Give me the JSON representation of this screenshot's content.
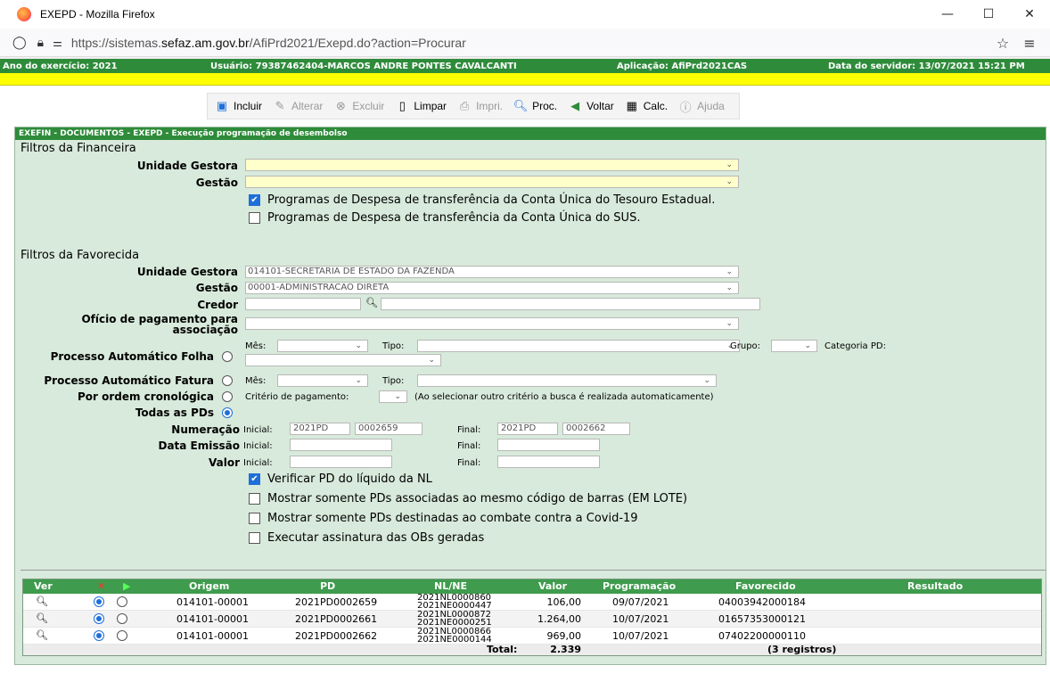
{
  "window": {
    "title": "EXEPD - Mozilla Firefox"
  },
  "browser": {
    "url_prefix": "https://sistemas.",
    "url_domain": "sefaz.am.gov.br",
    "url_path": "/AfiPrd2021/Exepd.do?action=Procurar"
  },
  "appbar": {
    "ano": "Ano do exercício: 2021",
    "usuario": "Usuário: 79387462404-MARCOS ANDRE PONTES CAVALCANTI",
    "aplicacao": "Aplicação: AfiPrd2021CAS",
    "data": "Data do servidor: 13/07/2021 15:21 PM"
  },
  "toolbar": {
    "incluir": "Incluir",
    "alterar": "Alterar",
    "excluir": "Excluir",
    "limpar": "Limpar",
    "imprimir": "Impri.",
    "proc": "Proc.",
    "voltar": "Voltar",
    "calc": "Calc.",
    "ajuda": "Ajuda"
  },
  "panel": {
    "title": "EXEFIN - DOCUMENTOS - EXEPD - Execução programação de desembolso"
  },
  "financeira": {
    "section": "Filtros da Financeira",
    "unidade_label": "Unidade Gestora",
    "gestao_label": "Gestão",
    "chk_tesouro": "Programas de Despesa de transferência da Conta Única do Tesouro Estadual.",
    "chk_sus": "Programas de Despesa de transferência da Conta Única do SUS."
  },
  "favorecida": {
    "section": "Filtros da Favorecida",
    "unidade_label": "Unidade Gestora",
    "unidade_value": "014101-SECRETARIA DE ESTADO DA FAZENDA",
    "gestao_label": "Gestão",
    "gestao_value": "00001-ADMINISTRACAO DIRETA",
    "credor_label": "Credor",
    "oficio_label_1": "Ofício de pagamento para",
    "oficio_label_2": "associação",
    "folha_label": "Processo Automático Folha",
    "fatura_label": "Processo Automático Fatura",
    "mes": "Mês:",
    "tipo": "Tipo:",
    "grupo": "Grupo:",
    "categoria": "Categoria PD:",
    "cronologica_label": "Por ordem cronológica",
    "criterio": "Critério de pagamento:",
    "criterio_note": "(Ao selecionar outro critério a busca é realizada automaticamente)",
    "todas_label": "Todas as PDs",
    "numeracao_label": "Numeração",
    "inicial": "Inicial:",
    "final": "Final:",
    "num_ini_a": "2021PD",
    "num_ini_b": "0002659",
    "num_fin_a": "2021PD",
    "num_fin_b": "0002662",
    "data_label": "Data Emissão",
    "valor_label": "Valor",
    "chk_verificar": "Verificar PD do líquido da NL",
    "chk_lote": "Mostrar somente PDs associadas ao mesmo código de barras (EM LOTE)",
    "chk_covid": "Mostrar somente PDs destinadas ao combate contra a Covid-19",
    "chk_assinatura": "Executar assinatura das OBs geradas"
  },
  "table": {
    "headers": {
      "ver": "Ver",
      "x": "✕",
      "origem": "Origem",
      "pd": "PD",
      "nlne": "NL/NE",
      "valor": "Valor",
      "programacao": "Programação",
      "favorecido": "Favorecido",
      "resultado": "Resultado"
    },
    "rows": [
      {
        "origem": "014101-00001",
        "pd": "2021PD0002659",
        "nl": "2021NL0000860",
        "ne": "2021NE0000447",
        "valor": "106,00",
        "programacao": "09/07/2021",
        "favorecido": "04003942000184"
      },
      {
        "origem": "014101-00001",
        "pd": "2021PD0002661",
        "nl": "2021NL0000872",
        "ne": "2021NE0000251",
        "valor": "1.264,00",
        "programacao": "10/07/2021",
        "favorecido": "01657353000121"
      },
      {
        "origem": "014101-00001",
        "pd": "2021PD0002662",
        "nl": "2021NL0000866",
        "ne": "2021NE0000144",
        "valor": "969,00",
        "programacao": "10/07/2021",
        "favorecido": "07402200000110"
      }
    ],
    "total_label": "Total:",
    "total_value": "2.339",
    "registros": "(3 registros)"
  }
}
